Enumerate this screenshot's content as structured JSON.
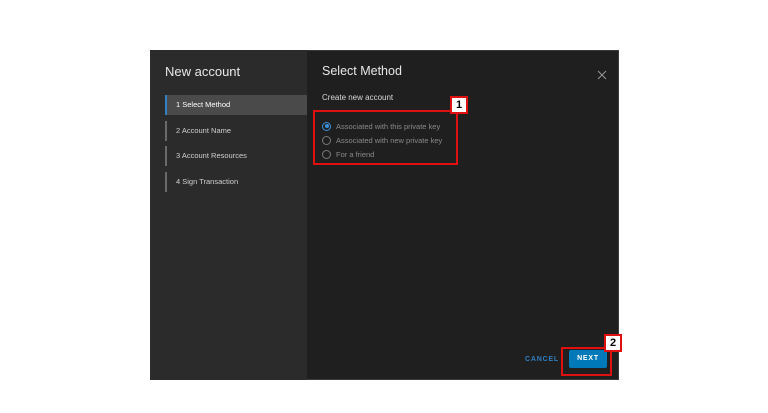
{
  "dialog": {
    "title": "New account",
    "close_icon": "close-icon"
  },
  "wizard_steps": [
    {
      "label": "1 Select Method",
      "active": true
    },
    {
      "label": "2 Account Name",
      "active": false
    },
    {
      "label": "3 Account Resources",
      "active": false
    },
    {
      "label": "4 Sign Transaction",
      "active": false
    }
  ],
  "content": {
    "section_title": "Select Method",
    "subheading": "Create new account",
    "options": [
      {
        "label": "Associated with this private key",
        "checked": true
      },
      {
        "label": "Associated with new private key",
        "checked": false
      },
      {
        "label": "For a friend",
        "checked": false
      }
    ]
  },
  "footer": {
    "cancel_label": "CANCEL",
    "next_label": "NEXT"
  },
  "annotations": {
    "badge_1": "1",
    "badge_2": "2"
  },
  "colors": {
    "accent": "#0079b8",
    "annotation": "#e01010"
  }
}
